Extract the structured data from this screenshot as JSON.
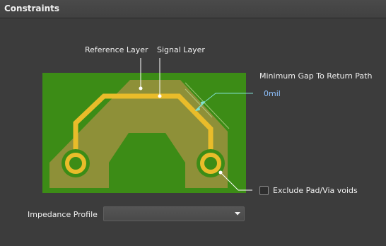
{
  "panel": {
    "title": "Constraints"
  },
  "diagram": {
    "reference_layer_label": "Reference Layer",
    "signal_layer_label": "Signal Layer",
    "min_gap_label": "Minimum Gap To Return Path",
    "min_gap_value": "0mil",
    "colors": {
      "board": "#3c8c16",
      "reference_plane": "#8e9038",
      "trace": "#e9bc2a",
      "callout_line": "#ffffff",
      "gap_arrow": "#7fe0d0"
    }
  },
  "exclude_voids": {
    "label": "Exclude Pad/Via voids",
    "checked": false
  },
  "impedance_profile": {
    "label": "Impedance Profile",
    "value": "",
    "icon": "chevron-down-icon"
  }
}
